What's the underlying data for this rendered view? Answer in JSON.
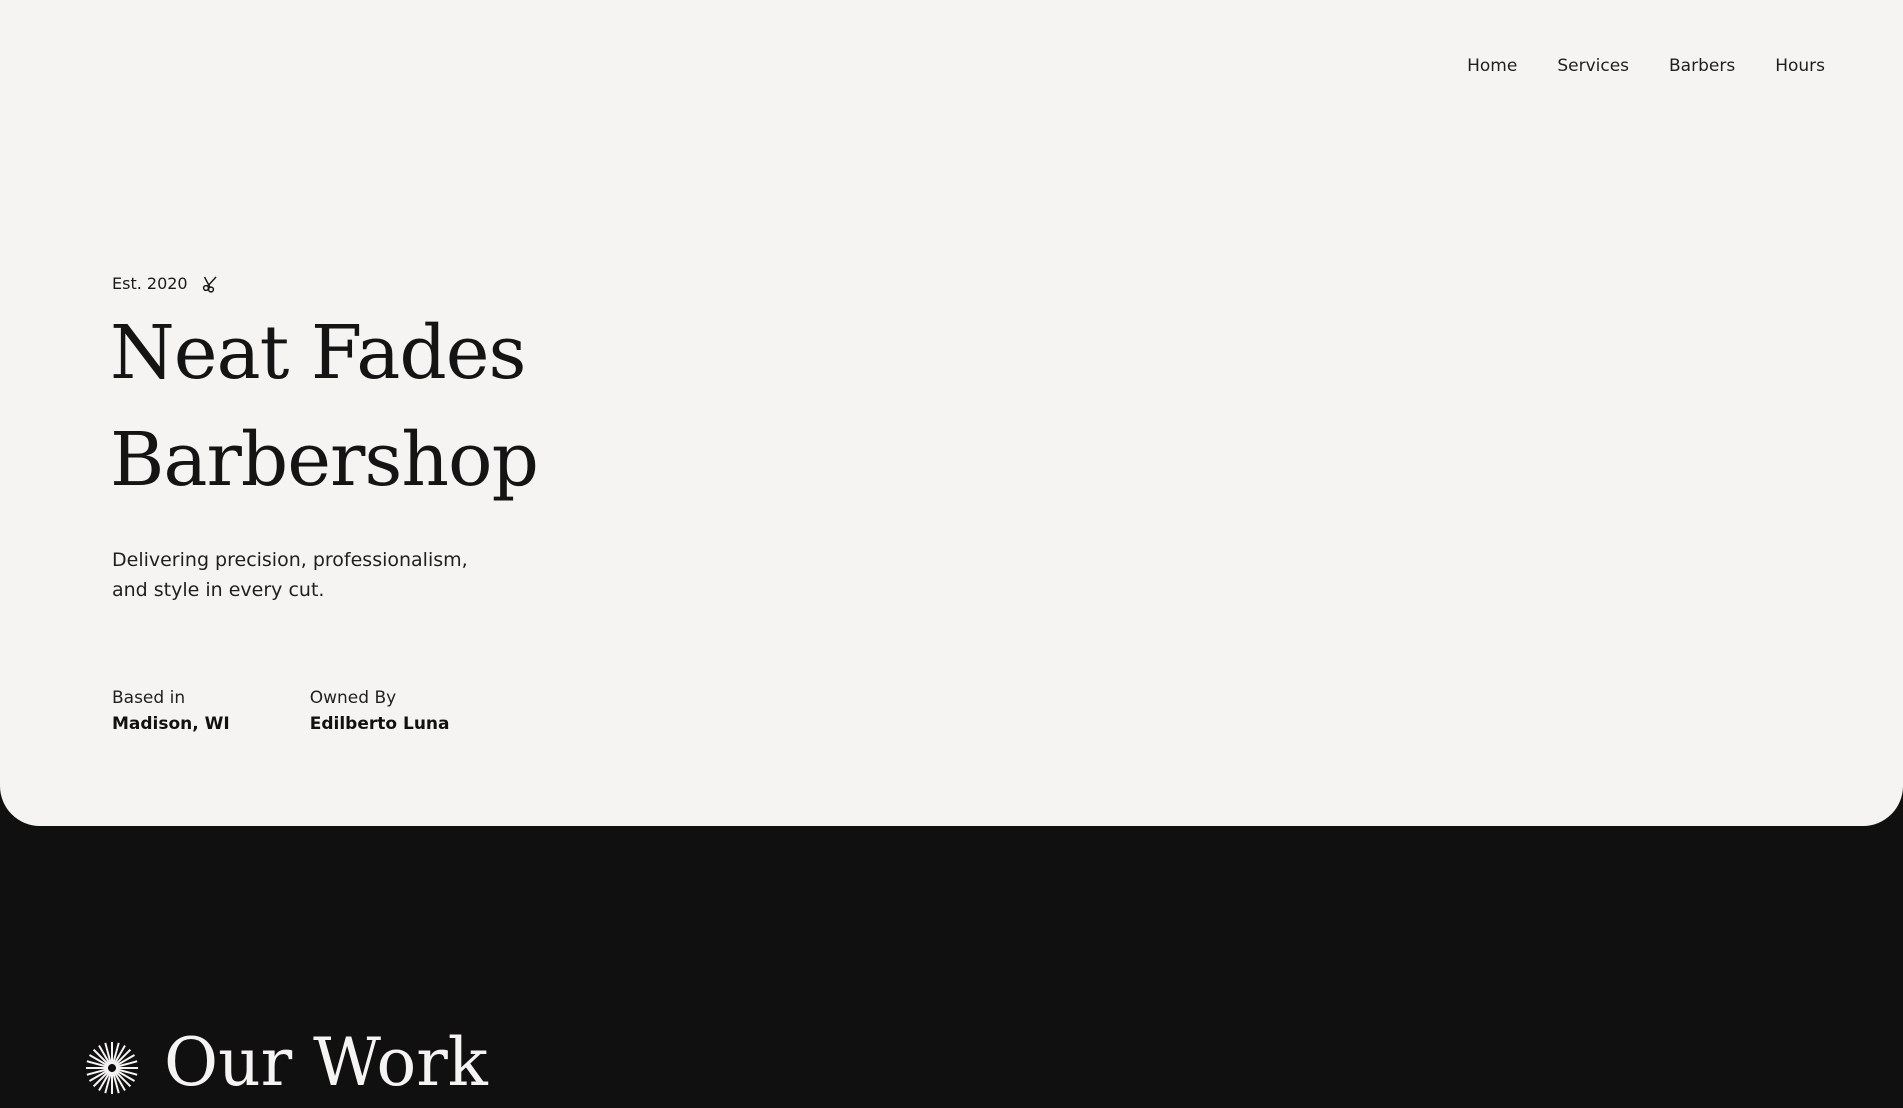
{
  "nav": {
    "items": [
      {
        "label": "Home"
      },
      {
        "label": "Services"
      },
      {
        "label": "Barbers"
      },
      {
        "label": "Hours"
      }
    ]
  },
  "hero": {
    "established": "Est. 2020",
    "established_icon": "scissors-icon",
    "title_line1": "Neat Fades",
    "title_line2": "Barbershop",
    "tagline_line1": "Delivering precision, professionalism,",
    "tagline_line2": "and style in every cut.",
    "based_label": "Based in",
    "based_value": "Madison, WI",
    "owner_label": "Owned By",
    "owner_value": "Edilberto Luna"
  },
  "work": {
    "icon": "starburst-icon",
    "title": "Our Work"
  },
  "colors": {
    "hero_bg": "#f5f4f2",
    "dark_bg": "#101010",
    "text": "#141414"
  }
}
